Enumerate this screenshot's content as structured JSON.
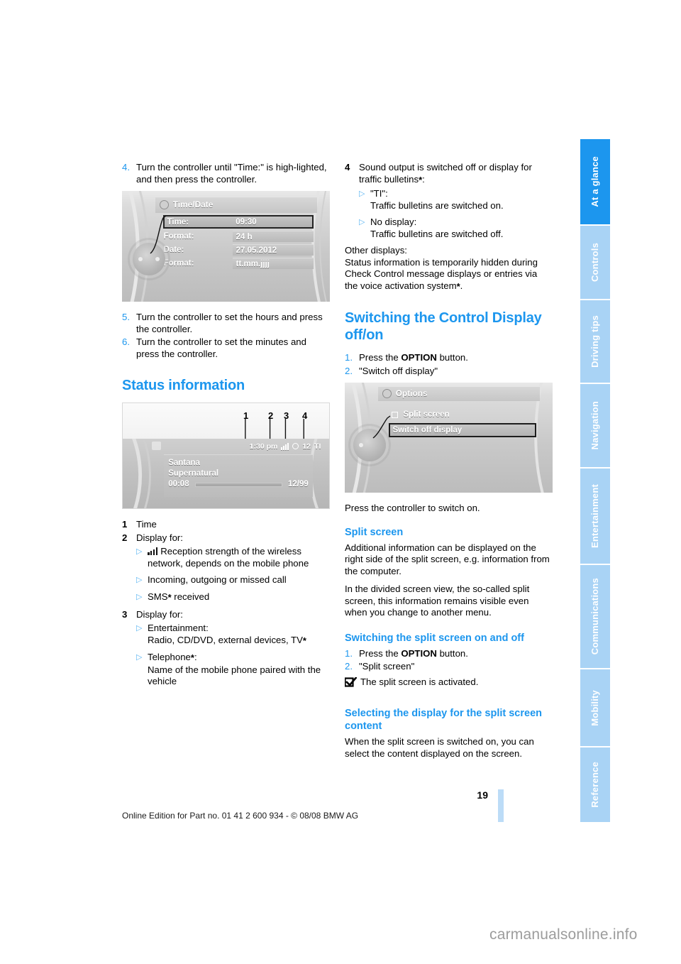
{
  "document": {
    "page_number": "19",
    "credit_line": "Online Edition for Part no. 01 41 2 600 934 - © 08/08 BMW AG",
    "watermark": "carmanualsonline.info",
    "accent_color": "#1c96ee",
    "tab_inactive_color": "#a9d3f5"
  },
  "sidebar": {
    "tabs": [
      {
        "label": "At a glance",
        "active": true
      },
      {
        "label": "Controls",
        "active": false
      },
      {
        "label": "Driving tips",
        "active": false
      },
      {
        "label": "Navigation",
        "active": false
      },
      {
        "label": "Entertainment",
        "active": false
      },
      {
        "label": "Communications",
        "active": false
      },
      {
        "label": "Mobility",
        "active": false
      },
      {
        "label": "Reference",
        "active": false
      }
    ]
  },
  "left_column": {
    "step4": {
      "num": "4.",
      "text": "Turn the controller until \"Time:\" is high-lighted, and then press the controller."
    },
    "figure_time_date": {
      "title": "Time/Date",
      "rows": [
        {
          "label": "Time:",
          "value": "09:30",
          "selected": true
        },
        {
          "label": "Format:",
          "value": "24 h",
          "selected": false
        },
        {
          "label": "Date:",
          "value": "27.05.2012",
          "selected": false
        },
        {
          "label": "Format:",
          "value": "tt.mm.jjjj",
          "selected": false
        }
      ]
    },
    "step5": {
      "num": "5.",
      "text": "Turn the controller to set the hours and press the controller."
    },
    "step6": {
      "num": "6.",
      "text": "Turn the controller to set the minutes and press the controller."
    },
    "heading_status": "Status information",
    "figure_status": {
      "callouts": [
        "1",
        "2",
        "3",
        "4"
      ],
      "statusbar": {
        "time": "1:30 pm",
        "temperature": "12",
        "traffic": "TI"
      },
      "media": {
        "artist": "Santana",
        "album": "Supernatural",
        "elapsed": "00:08",
        "track": "12/99"
      }
    },
    "legend": [
      {
        "num": "1",
        "text": "Time",
        "bullets": []
      },
      {
        "num": "2",
        "text": "Display for:",
        "bullets": [
          {
            "icon": "signal-bars-icon",
            "text": "Reception strength of the wireless network, depends on the mobile phone"
          },
          {
            "icon": null,
            "text": "Incoming, outgoing or missed call"
          },
          {
            "icon": null,
            "text": "SMS* received"
          }
        ]
      },
      {
        "num": "3",
        "text": "Display for:",
        "bullets": [
          {
            "icon": null,
            "text": "Entertainment:\nRadio, CD/DVD, external devices, TV*"
          },
          {
            "icon": null,
            "text": "Telephone*:\nName of the mobile phone paired with the vehicle"
          }
        ]
      }
    ]
  },
  "right_column": {
    "legend4": {
      "num": "4",
      "text": "Sound output is switched off or display for traffic bulletins*:",
      "bullets": [
        {
          "text": "\"TI\":\nTraffic bulletins are switched on."
        },
        {
          "text": "No display:\nTraffic bulletins are switched off."
        }
      ]
    },
    "other_displays": {
      "label": "Other displays:",
      "body": "Status information is temporarily hidden during Check Control message displays or entries via the voice activation system*."
    },
    "heading_switching": "Switching the Control Display off/on",
    "steps": [
      {
        "num": "1.",
        "pre": "Press the ",
        "bold": "OPTION",
        "post": " button."
      },
      {
        "num": "2.",
        "pre": "\"Switch off display\"",
        "bold": "",
        "post": ""
      }
    ],
    "figure_options": {
      "title": "Options",
      "rows": [
        {
          "label": "Split screen",
          "checkbox": true,
          "selected": false
        },
        {
          "label": "Switch off display",
          "checkbox": false,
          "selected": true
        }
      ]
    },
    "press_controller": "Press the controller to switch on.",
    "heading_split": "Split screen",
    "split_body_1": "Additional information can be displayed on the right side of the split screen, e.g. information from the computer.",
    "split_body_2": "In the divided screen view, the so-called split screen, this information remains visible even when you change to another menu.",
    "heading_switch_split": "Switching the split screen on and off",
    "split_steps": [
      {
        "num": "1.",
        "pre": "Press the ",
        "bold": "OPTION",
        "post": " button."
      },
      {
        "num": "2.",
        "pre": "\"Split screen\"",
        "bold": "",
        "post": ""
      }
    ],
    "split_confirm": "The split screen is activated.",
    "heading_selecting": "Selecting the display for the split screen content",
    "selecting_body": "When the split screen is switched on, you can select the content displayed on the screen."
  }
}
